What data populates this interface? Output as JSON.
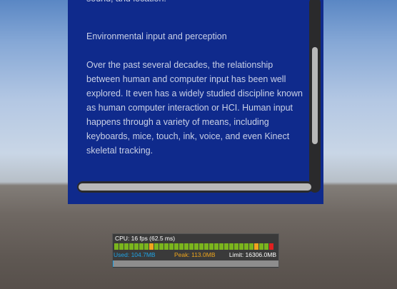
{
  "panel": {
    "lines": {
      "top_fragment": "sound, and location.",
      "heading": "Environmental input and perception",
      "body": [
        "Over the past several decades, the relationship",
        "between human and computer input has been well",
        "explored. It even has a widely studied discipline known",
        "as human computer interaction or HCI. Human input",
        "happens through a variety of means, including",
        "keyboards, mice, touch, ink, voice, and even Kinect",
        "skeletal tracking."
      ]
    },
    "colors": {
      "background": "#0f2a8c",
      "text": "#c9d0e6",
      "scrollbar_track": "#2a2a2c",
      "scrollbar_thumb": "#b8b8b8"
    }
  },
  "profiler": {
    "cpu_text": "CPU: 16 fps (62.5 ms)",
    "used_text": "Used: 104.7MB",
    "peak_text": "Peak: 113.0MB",
    "limit_text": "Limit: 16306.0MB",
    "memory_used_fraction": 0.006,
    "frame_bars": [
      "green",
      "green",
      "green",
      "green",
      "green",
      "green",
      "green",
      "orange",
      "green",
      "green",
      "green",
      "green",
      "green",
      "green",
      "green",
      "green",
      "green",
      "green",
      "green",
      "green",
      "green",
      "green",
      "green",
      "green",
      "green",
      "green",
      "green",
      "green",
      "orange",
      "green",
      "green",
      "red"
    ],
    "colors": {
      "green": "#7ab51d",
      "orange": "#f0a51c",
      "red": "#e02020",
      "used": "#1fa3e6",
      "peak": "#f0a51c",
      "limit": "#ffffff",
      "cpu": "#ffffff",
      "track": "#8d8d8d"
    }
  }
}
